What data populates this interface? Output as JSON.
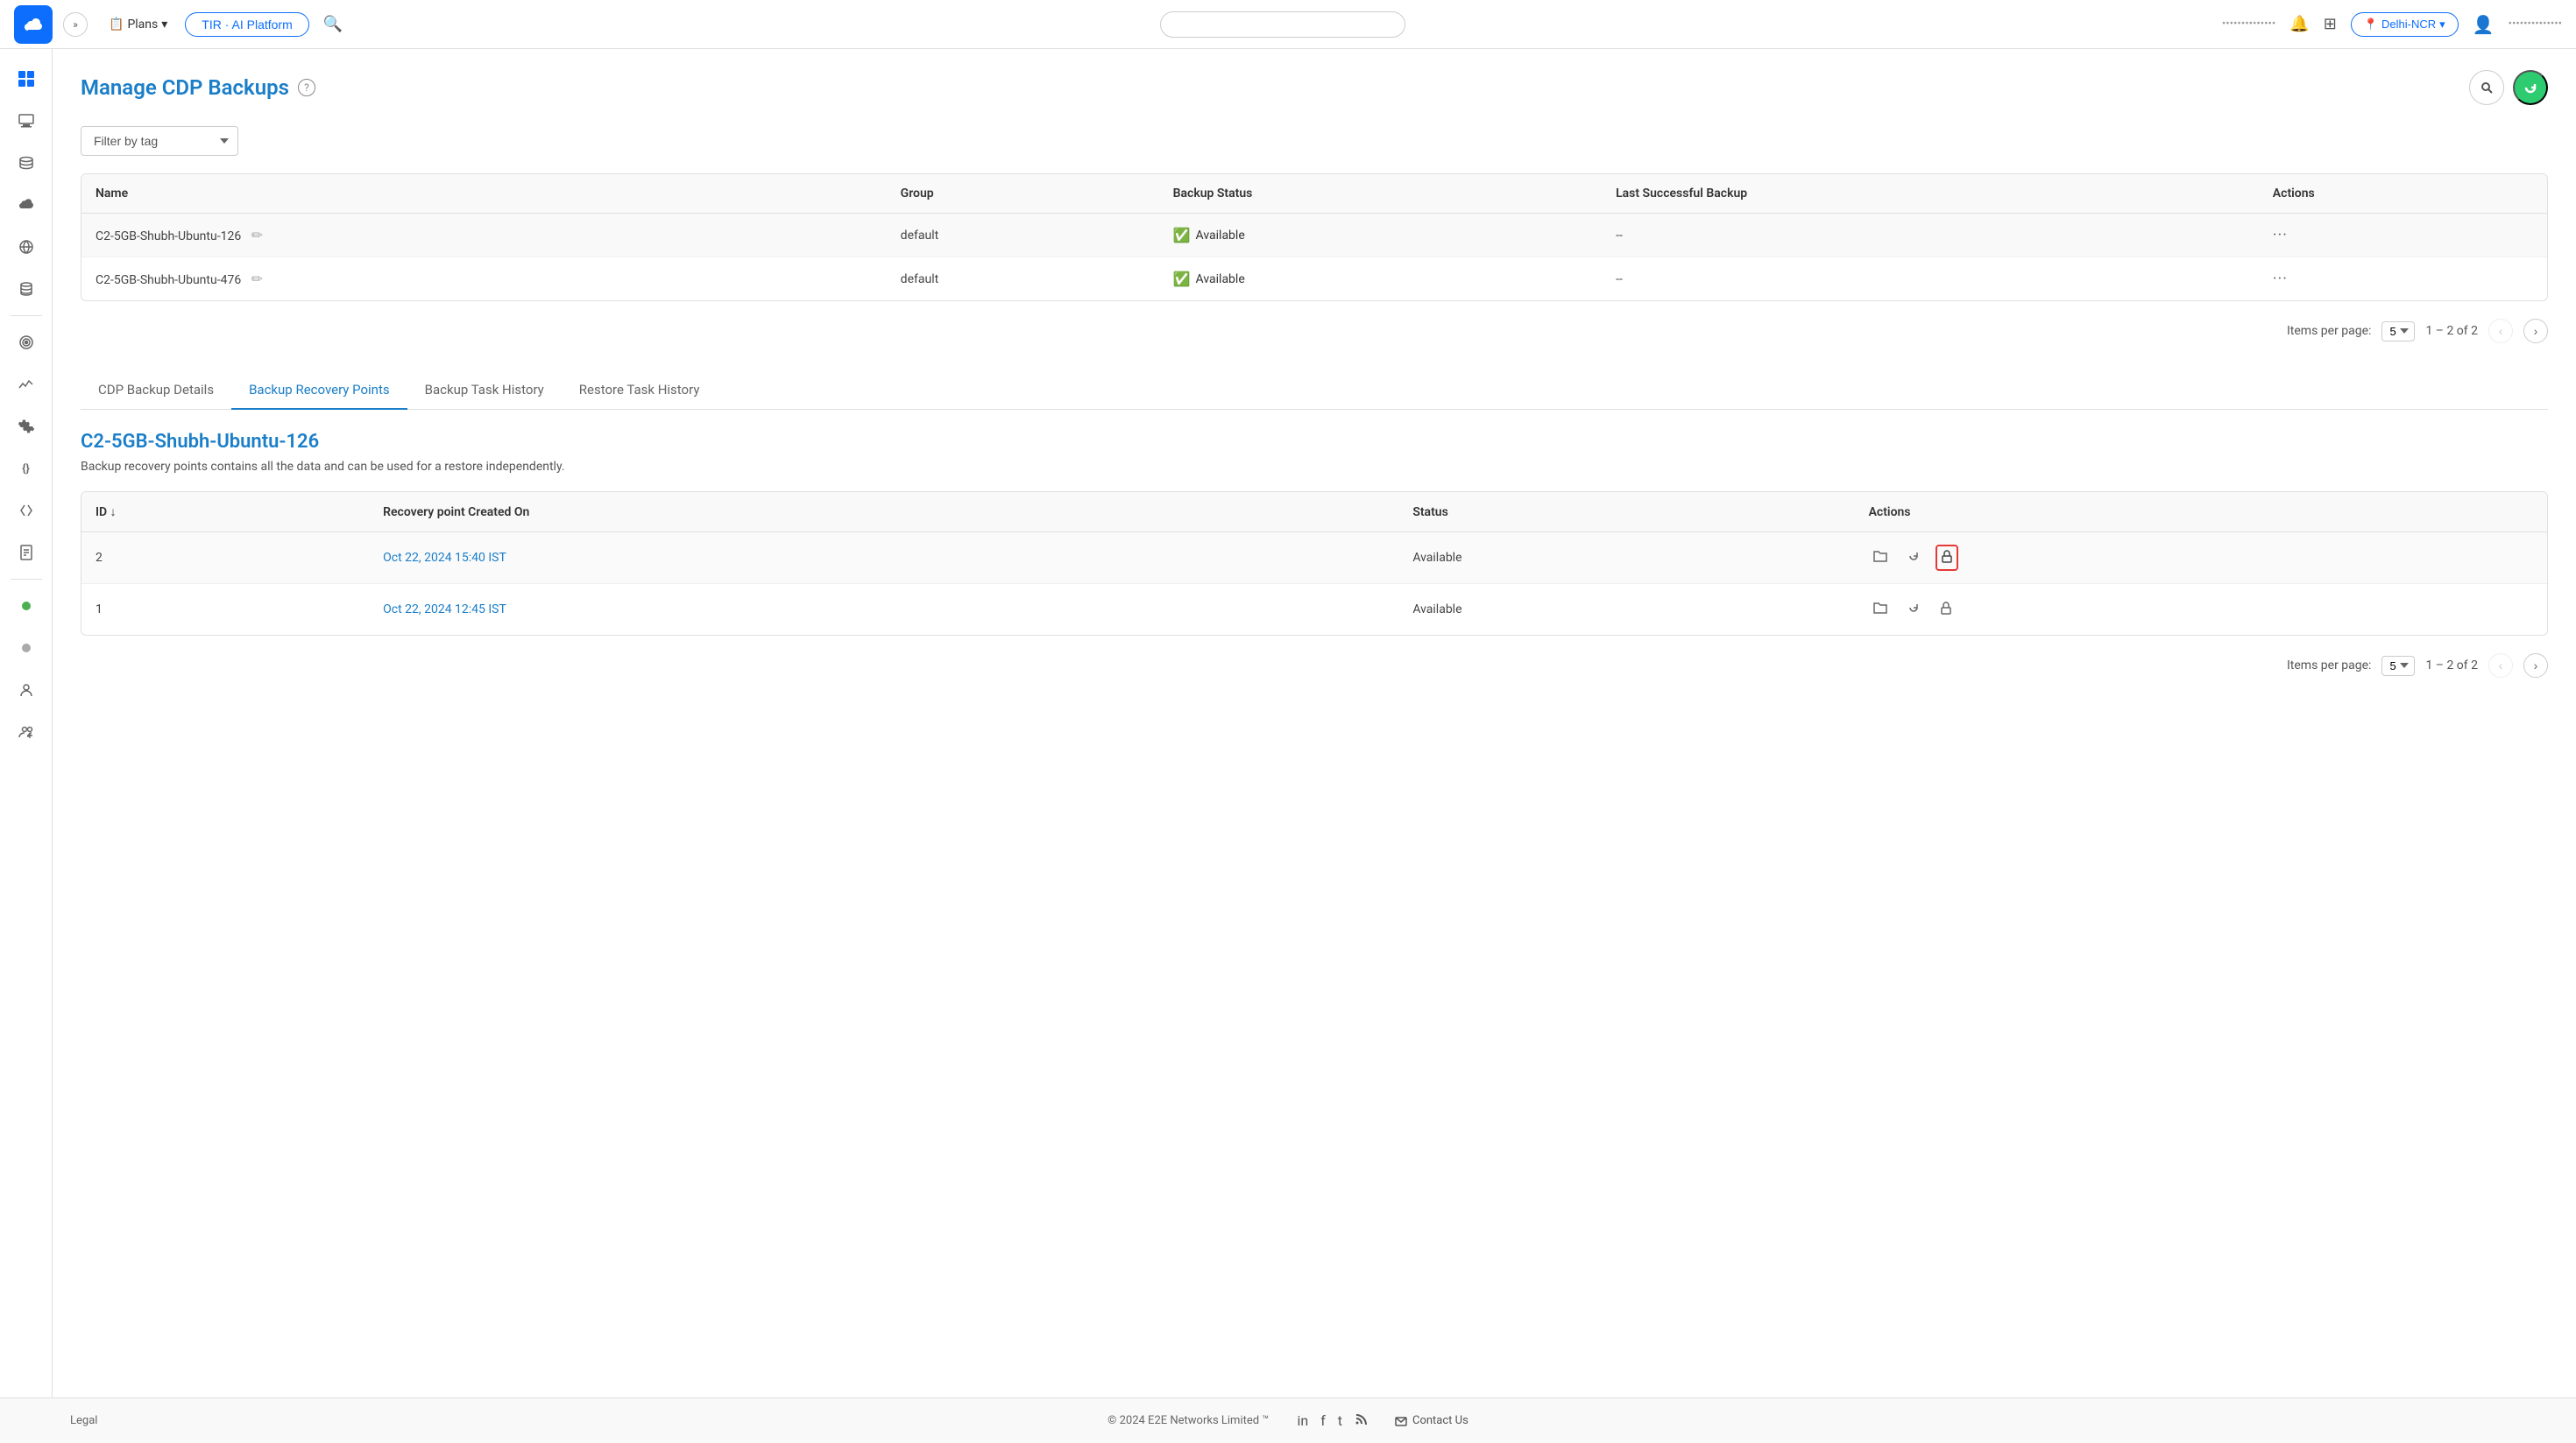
{
  "navbar": {
    "logo_symbol": "☁",
    "expand_symbol": "»",
    "plans_label": "Plans",
    "tir_btn_label": "TIR · AI Platform",
    "search_placeholder": "",
    "region_label": "Delhi-NCR",
    "bell_symbol": "🔔",
    "grid_symbol": "⋮⋮⋮",
    "user_symbol": "👤",
    "account_text": "••••••••••••••"
  },
  "sidebar": {
    "items": [
      {
        "symbol": "⊞",
        "name": "dashboard"
      },
      {
        "symbol": "▦",
        "name": "compute"
      },
      {
        "symbol": "⬡",
        "name": "storage"
      },
      {
        "symbol": "⛅",
        "name": "cloud"
      },
      {
        "symbol": "⚡",
        "name": "network"
      },
      {
        "symbol": "▣",
        "name": "databases"
      },
      {
        "symbol": "🎯",
        "name": "targets"
      },
      {
        "symbol": "📊",
        "name": "monitoring"
      },
      {
        "symbol": "⚙",
        "name": "settings"
      },
      {
        "symbol": "{}",
        "name": "api"
      },
      {
        "symbol": "◁",
        "name": "git"
      },
      {
        "symbol": "📄",
        "name": "docs"
      },
      {
        "symbol": "↻",
        "name": "refresh"
      },
      {
        "symbol": "👤",
        "name": "account"
      },
      {
        "symbol": "👥",
        "name": "team"
      }
    ]
  },
  "page": {
    "title": "Manage CDP Backups",
    "help_symbol": "?",
    "filter_placeholder": "Filter by tag",
    "filter_options": [
      "Filter by tag"
    ]
  },
  "backups_table": {
    "columns": [
      "Name",
      "Group",
      "Backup Status",
      "Last Successful Backup",
      "Actions"
    ],
    "rows": [
      {
        "name": "C2-5GB-Shubh-Ubuntu-126",
        "group": "default",
        "status": "Available",
        "last_backup": "--",
        "actions": "···"
      },
      {
        "name": "C2-5GB-Shubh-Ubuntu-476",
        "group": "default",
        "status": "Available",
        "last_backup": "--",
        "actions": "···"
      }
    ],
    "pagination": {
      "items_per_page_label": "Items per page:",
      "items_per_page_value": "5",
      "page_info": "1 – 2 of 2"
    }
  },
  "tabs": [
    {
      "label": "CDP Backup Details",
      "active": false
    },
    {
      "label": "Backup Recovery Points",
      "active": true
    },
    {
      "label": "Backup Task History",
      "active": false
    },
    {
      "label": "Restore Task History",
      "active": false
    }
  ],
  "recovery_section": {
    "title": "C2-5GB-Shubh-Ubuntu-126",
    "description": "Backup recovery points contains all the data and can be used for a restore independently.",
    "table": {
      "columns": [
        "ID ↓",
        "Recovery point Created On",
        "Status",
        "Actions"
      ],
      "rows": [
        {
          "id": "2",
          "created_on": "Oct 22, 2024 15:40 IST",
          "status": "Available",
          "highlight_lock": true
        },
        {
          "id": "1",
          "created_on": "Oct 22, 2024 12:45 IST",
          "status": "Available",
          "highlight_lock": false
        }
      ],
      "pagination": {
        "items_per_page_label": "Items per page:",
        "items_per_page_value": "5",
        "page_info": "1 – 2 of 2"
      }
    }
  },
  "footer": {
    "copyright": "© 2024 E2E Networks Limited ™",
    "contact_label": "Contact Us",
    "social_icons": [
      "in",
      "f",
      "t",
      "rss"
    ]
  }
}
